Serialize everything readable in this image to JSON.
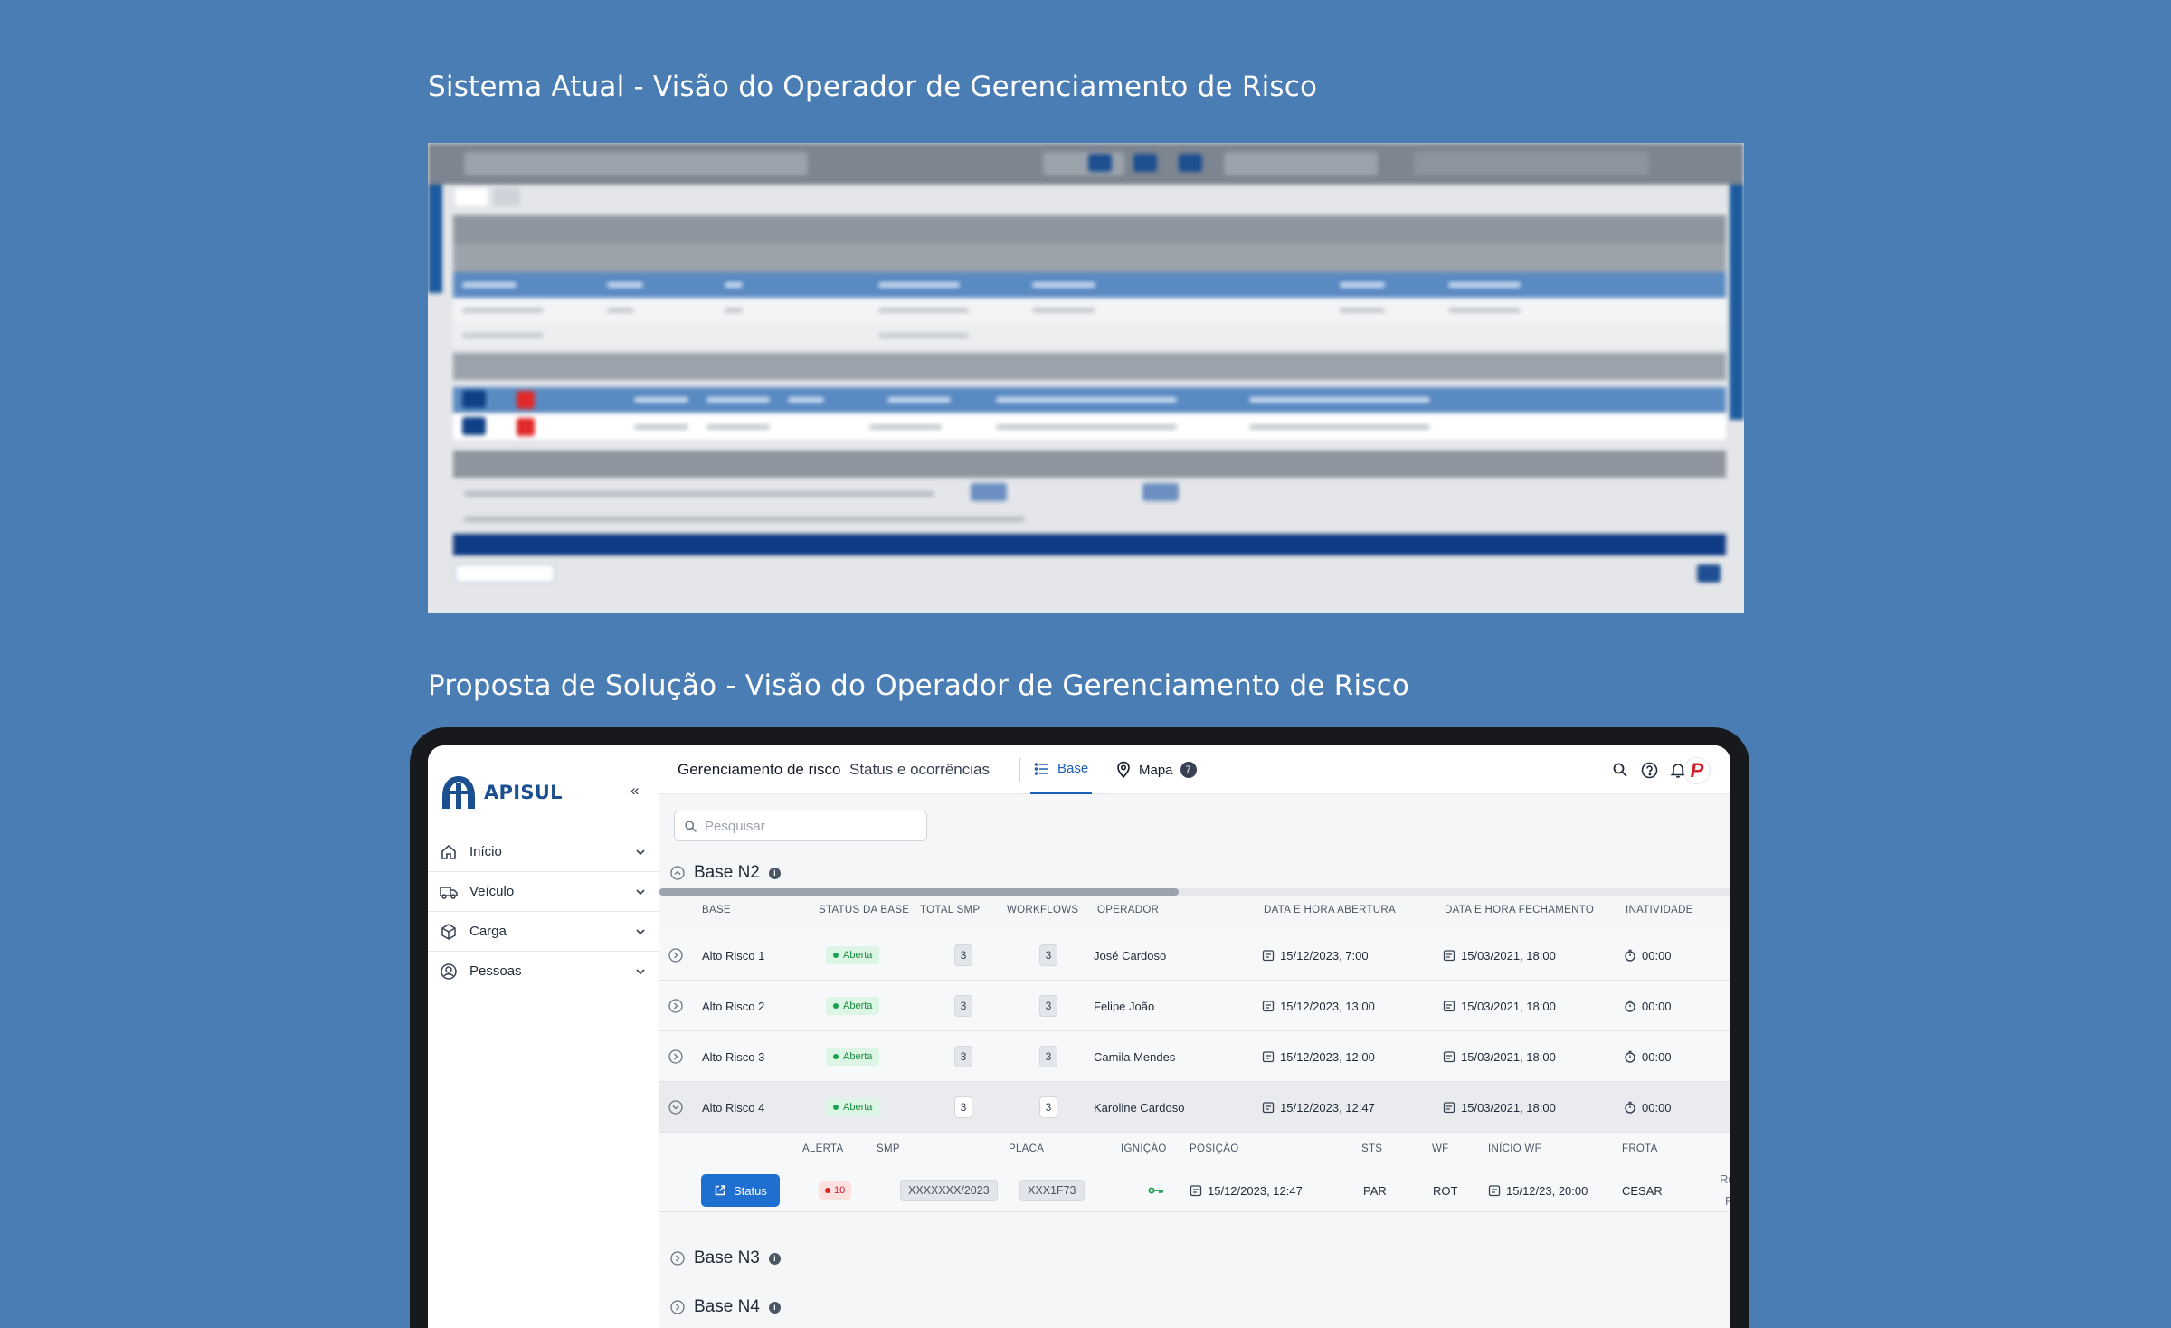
{
  "titles": {
    "current": "Sistema Atual - Visão do Operador de Gerenciamento de Risco",
    "proposal": "Proposta de Solução - Visão do Operador de Gerenciamento de Risco"
  },
  "colors": {
    "brand": "#1b4f8f",
    "accent": "#1d5fb8",
    "status_ok": "#158b3f",
    "alert": "#d11f2b"
  },
  "app": {
    "logo": "APISUL",
    "collapse_icon": "chevrons-left-icon",
    "nav": [
      {
        "label": "Início",
        "icon": "home-icon"
      },
      {
        "label": "Veículo",
        "icon": "truck-icon"
      },
      {
        "label": "Carga",
        "icon": "package-icon"
      },
      {
        "label": "Pessoas",
        "icon": "user-circle-icon"
      }
    ],
    "topbar": {
      "title": "Gerenciamento de risco",
      "subtitle": "Status e ocorrências",
      "tab_base": "Base",
      "tab_mapa": "Mapa",
      "mapa_badge": "7",
      "avatar_letter": "P"
    },
    "search": {
      "placeholder": "Pesquisar"
    },
    "groups": [
      "Base N2",
      "Base N3",
      "Base N4"
    ],
    "columns": [
      "BASE",
      "STATUS DA BASE",
      "TOTAL SMP",
      "WORKFLOWS",
      "OPERADOR",
      "DATA E HORA ABERTURA",
      "DATA E HORA FECHAMENTO",
      "INATIVIDADE"
    ],
    "rows": [
      {
        "base": "Alto Risco 1",
        "status": "Aberta",
        "total_smp": "3",
        "workflows": "3",
        "operador": "José Cardoso",
        "abertura": "15/12/2023, 7:00",
        "fechamento": "15/03/2021, 18:00",
        "inatividade": "00:00"
      },
      {
        "base": "Alto Risco 2",
        "status": "Aberta",
        "total_smp": "3",
        "workflows": "3",
        "operador": "Felipe João",
        "abertura": "15/12/2023, 13:00",
        "fechamento": "15/03/2021, 18:00",
        "inatividade": "00:00"
      },
      {
        "base": "Alto Risco 3",
        "status": "Aberta",
        "total_smp": "3",
        "workflows": "3",
        "operador": "Camila Mendes",
        "abertura": "15/12/2023, 12:00",
        "fechamento": "15/03/2021, 18:00",
        "inatividade": "00:00"
      },
      {
        "base": "Alto Risco 4",
        "status": "Aberta",
        "total_smp": "3",
        "workflows": "3",
        "operador": "Karoline Cardoso",
        "abertura": "15/12/2023, 12:47",
        "fechamento": "15/03/2021, 18:00",
        "inatividade": "00:00"
      }
    ],
    "detail": {
      "columns": [
        "ALERTA",
        "SMP",
        "PLACA",
        "IGNIÇÃO",
        "POSIÇÃO",
        "STS",
        "WF",
        "INÍCIO WF",
        "FROTA"
      ],
      "status_button": "Status",
      "alerta": "10",
      "smp": "XXXXXXX/2023",
      "placa": "XXX1F73",
      "ignicao_icon": "key-icon",
      "posicao": "15/12/2023, 12:47",
      "sts": "PAR",
      "wf": "ROT",
      "inicio_wf": "15/12/23, 20:00",
      "frota": "CESAR",
      "truncated_1": "Ru",
      "truncated_2": "R"
    }
  }
}
